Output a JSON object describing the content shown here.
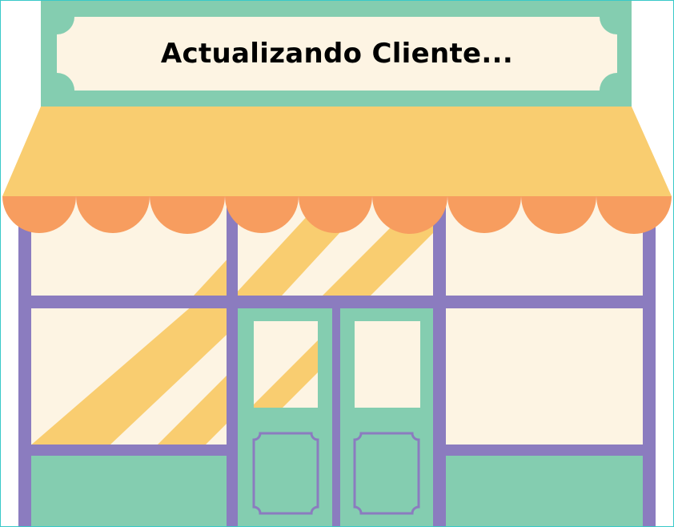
{
  "sign": {
    "text": "Actualizando Cliente..."
  },
  "colors": {
    "mint": "#84cdb0",
    "cream": "#fdf4e3",
    "awning_yellow": "#f9cd70",
    "scallop_orange": "#f79d5f",
    "frame_purple": "#8b7cbf",
    "border_teal": "#39c9c9"
  },
  "icons": [
    "storefront-illustration"
  ]
}
